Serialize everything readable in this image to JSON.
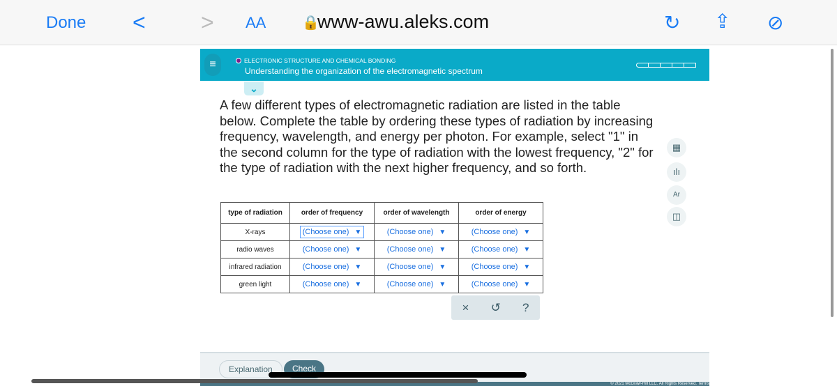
{
  "browser": {
    "done": "Done",
    "back": "<",
    "forward": ">",
    "text_size": "AA",
    "url": "www-awu.aleks.com"
  },
  "header": {
    "topic": "ELECTRONIC STRUCTURE AND CHEMICAL BONDING",
    "title": "Understanding the organization of the electromagnetic spectrum"
  },
  "question": "A few different types of electromagnetic radiation are listed in the table below. Complete the table by ordering these types of radiation by increasing frequency, wavelength, and energy per photon. For example, select \"1\" in the second column for the type of radiation with the lowest frequency, \"2\" for the type of radiation with the next higher frequency, and so forth.",
  "table": {
    "headers": [
      "type of radiation",
      "order of frequency",
      "order of wavelength",
      "order of energy"
    ],
    "rows": [
      {
        "type": "X-rays"
      },
      {
        "type": "radio waves"
      },
      {
        "type": "infrared radiation"
      },
      {
        "type": "green light"
      }
    ],
    "select_placeholder": "(Choose one)"
  },
  "actions": {
    "clear": "×",
    "undo": "↺",
    "help": "?"
  },
  "bottom": {
    "explanation": "Explanation",
    "check": "Check",
    "footer": "© 2021 McGraw-Hill LLC. All Rights Reserved.   Terms"
  }
}
